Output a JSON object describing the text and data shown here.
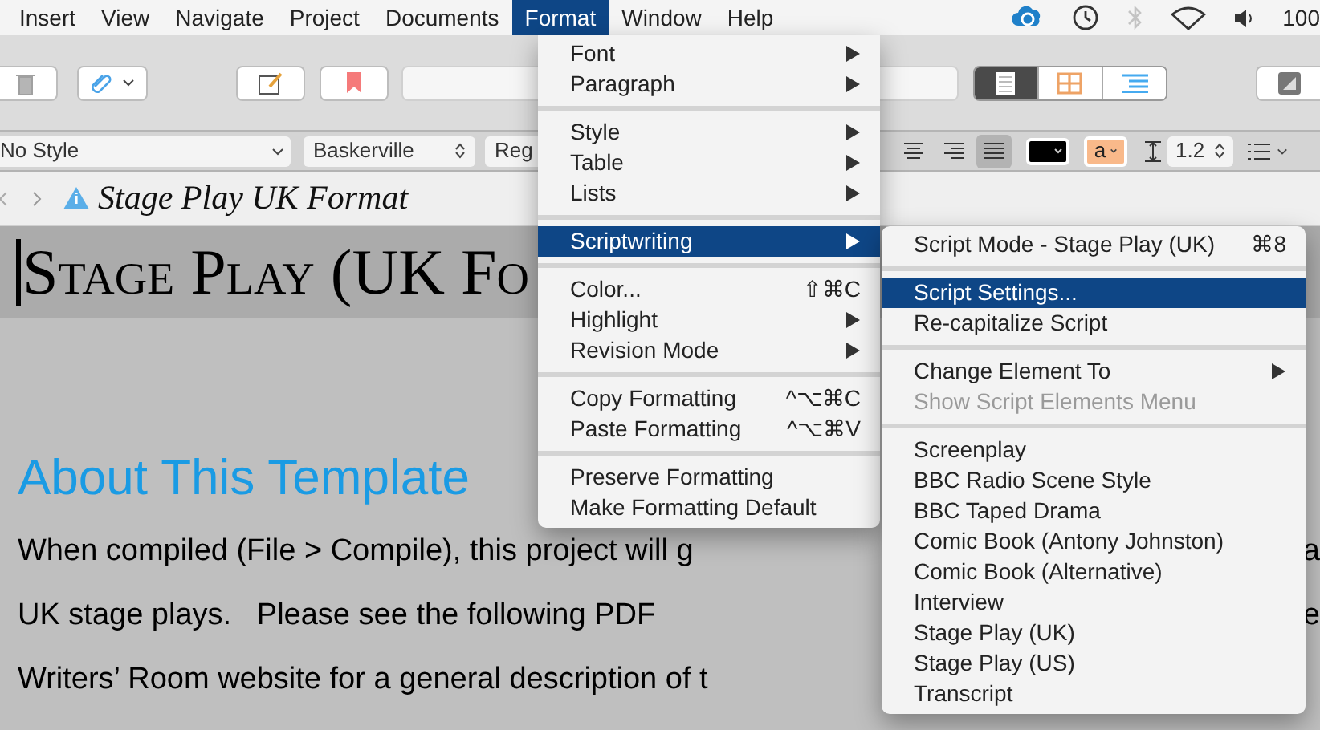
{
  "menu_bar": {
    "items": [
      {
        "label": "Insert",
        "selected": false
      },
      {
        "label": "View",
        "selected": false
      },
      {
        "label": "Navigate",
        "selected": false
      },
      {
        "label": "Project",
        "selected": false
      },
      {
        "label": "Documents",
        "selected": false
      },
      {
        "label": "Format",
        "selected": true
      },
      {
        "label": "Window",
        "selected": false
      },
      {
        "label": "Help",
        "selected": false
      }
    ],
    "battery": "100"
  },
  "toolbar": {
    "view_modes": [
      {
        "selected": true
      },
      {
        "selected": false
      },
      {
        "selected": false
      }
    ]
  },
  "format_bar": {
    "style": "No Style",
    "font": "Baskerville",
    "weight": "Reg",
    "alignment": [
      {
        "selected": false
      },
      {
        "selected": false
      },
      {
        "selected": true
      }
    ],
    "highlight": "a",
    "line_spacing": "1.2"
  },
  "header": {
    "title": "Stage Play UK Format"
  },
  "document": {
    "title": "Stage Play (UK Fo",
    "heading": "About This Template",
    "lines": [
      {
        "text": "When compiled (File > Compile), this project will g",
        "edge": "a"
      },
      {
        "text": "UK stage plays.   Please see the following PDF",
        "edge": "e"
      },
      {
        "text": "Writers’ Room website for a general description of t"
      }
    ]
  },
  "format_menu": {
    "groups": [
      [
        {
          "label": "Font",
          "submenu": true,
          "selected": false
        },
        {
          "label": "Paragraph",
          "submenu": true,
          "selected": false
        }
      ],
      [
        {
          "label": "Style",
          "submenu": true,
          "selected": false
        },
        {
          "label": "Table",
          "submenu": true,
          "selected": false
        },
        {
          "label": "Lists",
          "submenu": true,
          "selected": false
        }
      ],
      [
        {
          "label": "Scriptwriting",
          "submenu": true,
          "selected": true
        }
      ],
      [
        {
          "label": "Color...",
          "shortcut": "⇧⌘C",
          "selected": false
        },
        {
          "label": "Highlight",
          "submenu": true,
          "selected": false
        },
        {
          "label": "Revision Mode",
          "submenu": true,
          "selected": false
        }
      ],
      [
        {
          "label": "Copy Formatting",
          "shortcut": "^⌥⌘C",
          "selected": false
        },
        {
          "label": "Paste Formatting",
          "shortcut": "^⌥⌘V",
          "selected": false
        }
      ],
      [
        {
          "label": "Preserve Formatting",
          "selected": false
        },
        {
          "label": "Make Formatting Default",
          "selected": false
        }
      ]
    ]
  },
  "scriptwriting_menu": {
    "groups": [
      [
        {
          "label": "Script Mode - Stage Play (UK)",
          "shortcut": "⌘8",
          "selected": false
        }
      ],
      [
        {
          "label": "Script Settings...",
          "selected": true
        },
        {
          "label": "Re-capitalize Script",
          "selected": false
        }
      ],
      [
        {
          "label": "Change Element To",
          "submenu": true,
          "selected": false
        },
        {
          "label": "Show Script Elements Menu",
          "disabled": true,
          "selected": false
        }
      ],
      [
        {
          "label": "Screenplay",
          "selected": false
        },
        {
          "label": "BBC Radio Scene Style",
          "selected": false
        },
        {
          "label": "BBC Taped Drama",
          "selected": false
        },
        {
          "label": "Comic Book (Antony Johnston)",
          "selected": false
        },
        {
          "label": "Comic Book (Alternative)",
          "selected": false
        },
        {
          "label": "Interview",
          "selected": false
        },
        {
          "label": "Stage Play (UK)",
          "selected": false
        },
        {
          "label": "Stage Play (US)",
          "selected": false
        },
        {
          "label": "Transcript",
          "selected": false
        }
      ]
    ]
  }
}
